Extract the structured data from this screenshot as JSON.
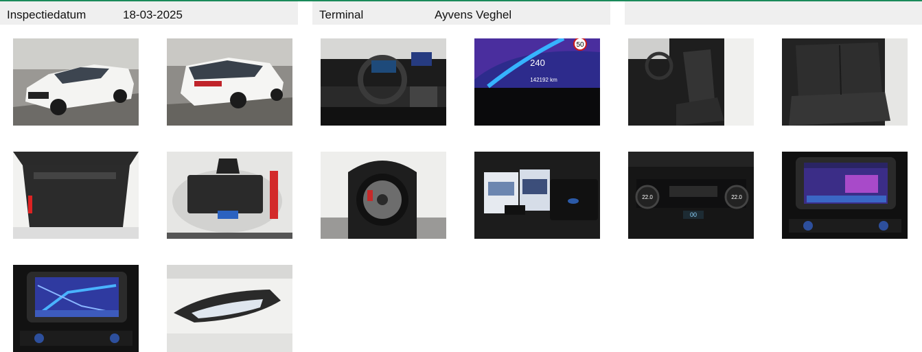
{
  "header": {
    "inspection": {
      "label": "Inspectiedatum",
      "value": "18-03-2025"
    },
    "terminal": {
      "label": "Terminal",
      "value": "Ayvens Veghel"
    }
  },
  "photos": {
    "cluster": {
      "speed_limit": "50",
      "speed": "240",
      "odometer": "142192 km"
    },
    "climate": {
      "left_temp": "22.0",
      "right_temp": "22.0",
      "display": "00"
    }
  },
  "colors": {
    "accent_line": "#1a8a5a",
    "header_bg": "#efefef"
  }
}
